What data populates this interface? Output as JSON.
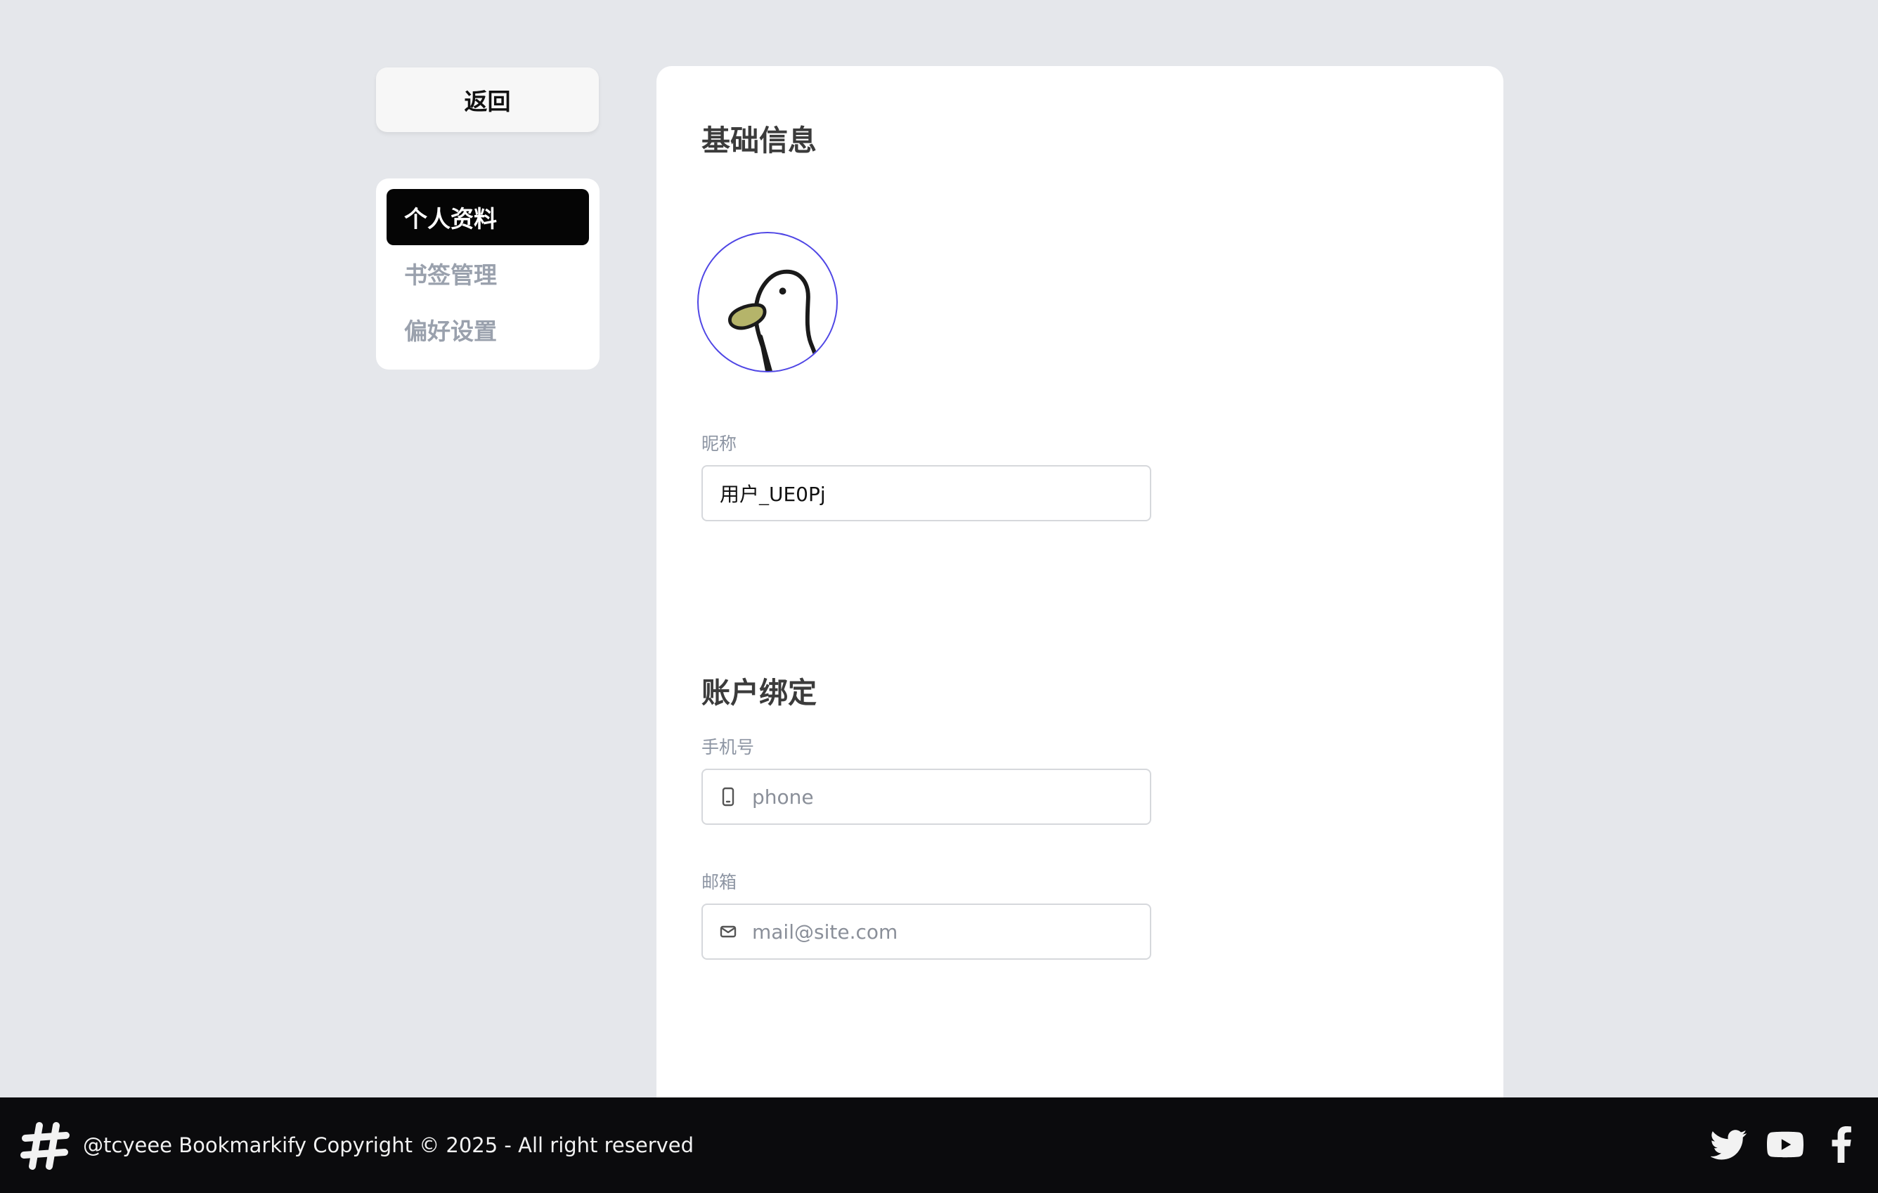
{
  "sidebar": {
    "back_label": "返回",
    "items": [
      {
        "label": "个人资料",
        "active": true
      },
      {
        "label": "书签管理",
        "active": false
      },
      {
        "label": "偏好设置",
        "active": false
      }
    ]
  },
  "main": {
    "basic_info": {
      "title": "基础信息",
      "avatar_icon": "duck-avatar",
      "nickname_label": "昵称",
      "nickname_value": "用户_UE0Pj"
    },
    "account_binding": {
      "title": "账户绑定",
      "phone_label": "手机号",
      "phone_placeholder": "phone",
      "phone_icon": "phone-icon",
      "email_label": "邮箱",
      "email_placeholder": "mail@site.com",
      "email_icon": "mail-icon"
    }
  },
  "footer": {
    "logo_icon": "hashtag-icon",
    "copyright": "@tcyeee Bookmarkify Copyright © 2025 - All right reserved",
    "social": [
      "twitter-icon",
      "youtube-icon",
      "facebook-icon"
    ]
  },
  "colors": {
    "background": "#e5e7eb",
    "active_nav": "#050505",
    "avatar_border": "#4f46e5",
    "footer": "#0b0b0d"
  }
}
